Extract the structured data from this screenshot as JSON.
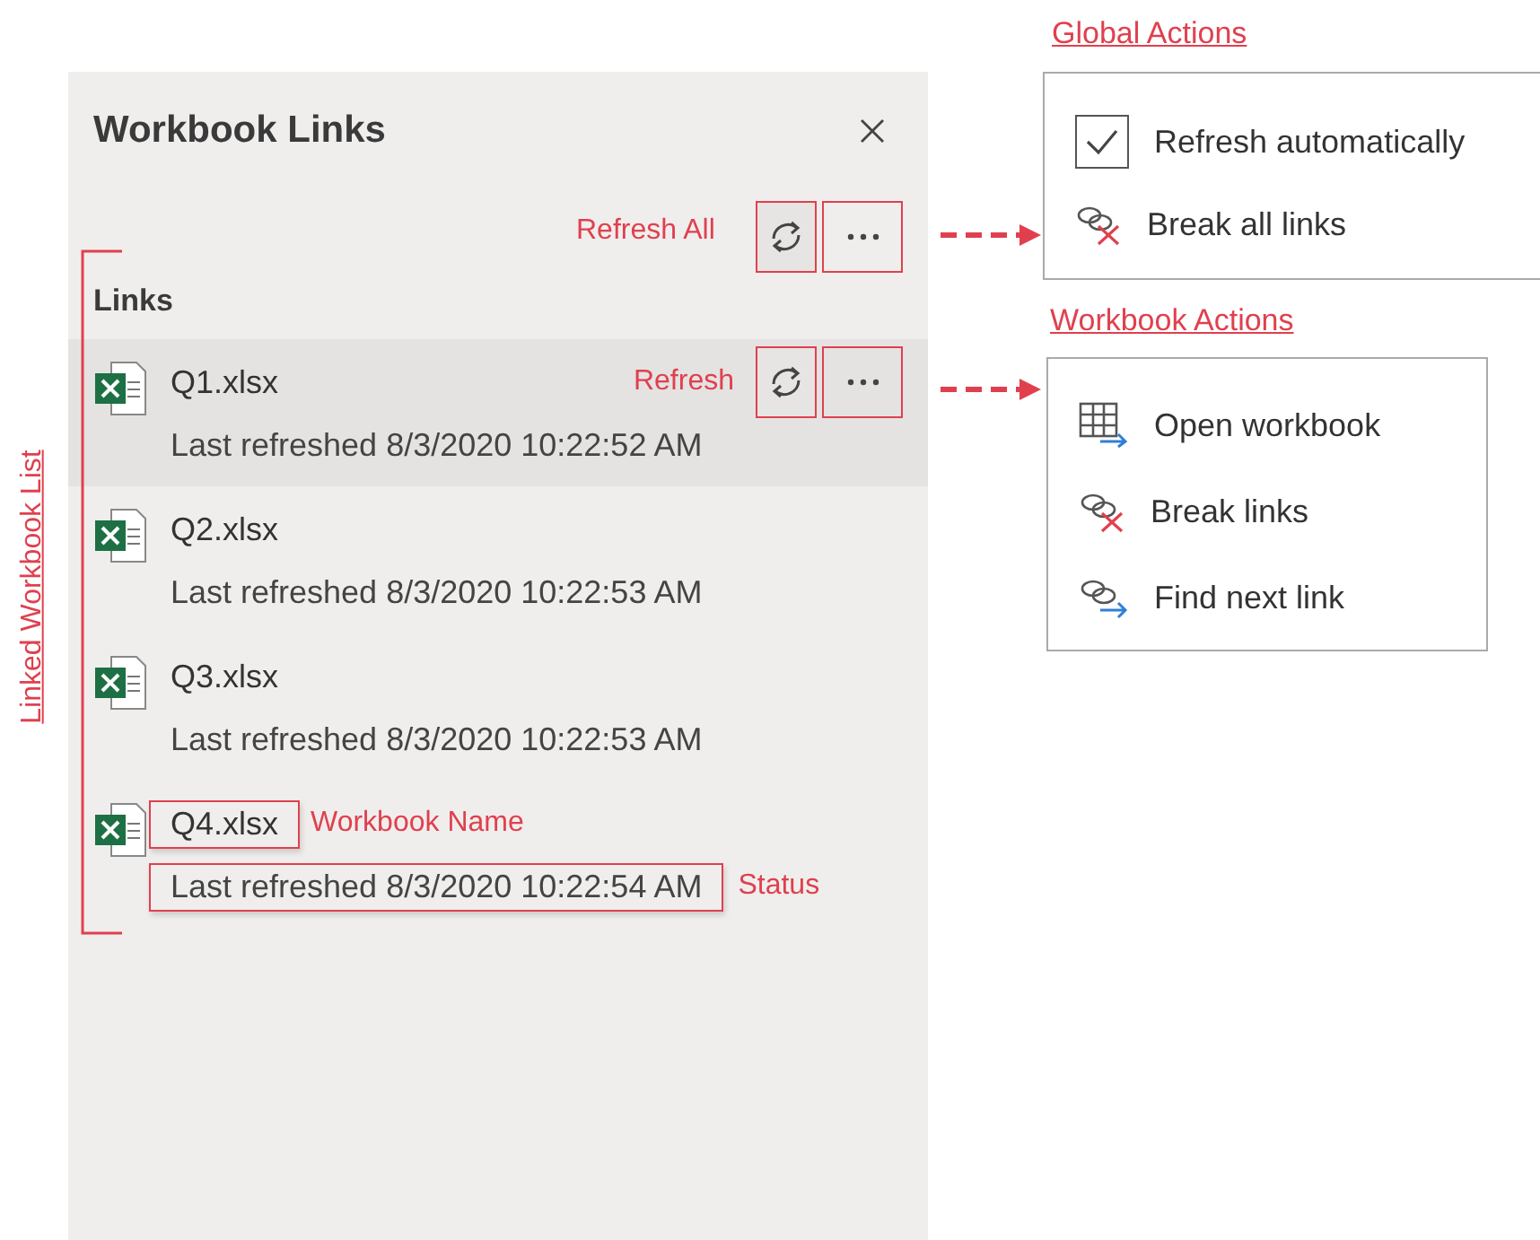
{
  "pane": {
    "title": "Workbook Links",
    "section_label": "Links"
  },
  "links": [
    {
      "name": "Q1.xlsx",
      "status": "Last refreshed 8/3/2020 10:22:52 AM",
      "selected": true,
      "annotated": false
    },
    {
      "name": "Q2.xlsx",
      "status": "Last refreshed 8/3/2020 10:22:53 AM",
      "selected": false,
      "annotated": false
    },
    {
      "name": "Q3.xlsx",
      "status": "Last refreshed 8/3/2020 10:22:53 AM",
      "selected": false,
      "annotated": false
    },
    {
      "name": "Q4.xlsx",
      "status": "Last refreshed 8/3/2020 10:22:54 AM",
      "selected": false,
      "annotated": true
    }
  ],
  "global_actions": {
    "title": "Global Actions",
    "items": [
      {
        "kind": "checkbox",
        "label": "Refresh automatically",
        "checked": true
      },
      {
        "kind": "break",
        "label": "Break all links"
      }
    ]
  },
  "workbook_actions": {
    "title": "Workbook Actions",
    "items": [
      {
        "kind": "open",
        "label": "Open workbook"
      },
      {
        "kind": "break",
        "label": "Break links"
      },
      {
        "kind": "find",
        "label": "Find next link"
      }
    ]
  },
  "annotations": {
    "refresh_all": "Refresh All",
    "refresh": "Refresh",
    "workbook_name": "Workbook Name",
    "status": "Status",
    "list": "Linked Workbook List"
  }
}
